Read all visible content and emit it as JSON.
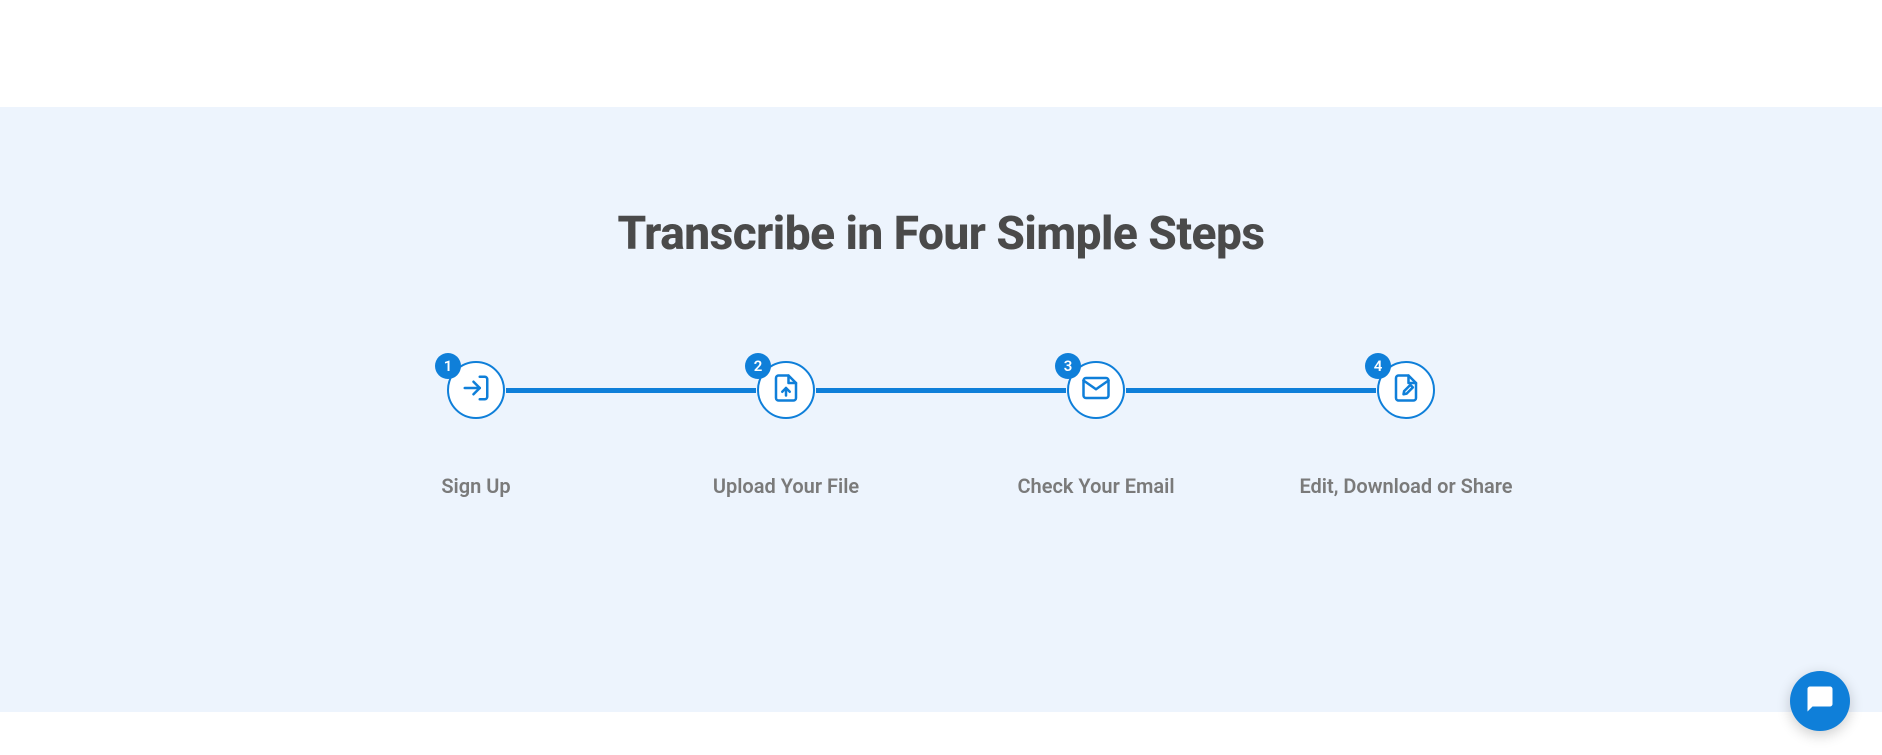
{
  "heading": "Transcribe in Four Simple Steps",
  "steps": [
    {
      "number": "1",
      "label": "Sign Up",
      "icon": "login-icon"
    },
    {
      "number": "2",
      "label": "Upload Your File",
      "icon": "upload-file-icon"
    },
    {
      "number": "3",
      "label": "Check Your Email",
      "icon": "email-icon"
    },
    {
      "number": "4",
      "label": "Edit, Download or Share",
      "icon": "edit-file-icon"
    }
  ],
  "colors": {
    "accent": "#0f7fd9",
    "background": "#edf4fd",
    "heading": "#4a4a4a",
    "label": "#7a7a7a"
  },
  "chat": {
    "name": "chat-widget"
  }
}
